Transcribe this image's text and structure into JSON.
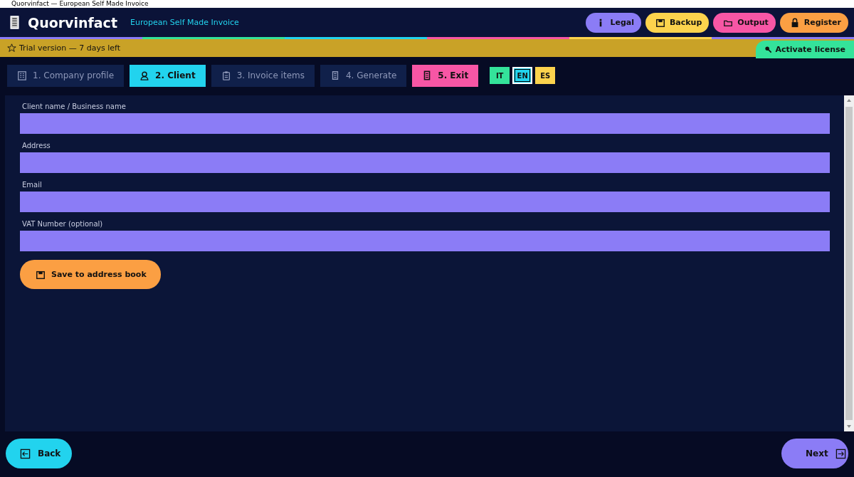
{
  "window": {
    "title": "Quorvinfact — European Self Made Invoice"
  },
  "header": {
    "app_name": "Quorvinfact",
    "subtitle": "European Self Made Invoice",
    "buttons": [
      {
        "label": "Legal",
        "color": "#8b7cf6"
      },
      {
        "label": "Backup",
        "color": "#fcd34d"
      },
      {
        "label": "Output",
        "color": "#f756a5"
      },
      {
        "label": "Register",
        "color": "#fb9f43"
      }
    ]
  },
  "trial_bar": {
    "text": "Trial version — 7 days left",
    "action": "Activate license"
  },
  "steps": [
    {
      "label": "1. Company profile",
      "kind": "step",
      "selected": false
    },
    {
      "label": "2. Client",
      "kind": "step",
      "selected": true
    },
    {
      "label": "3. Invoice items",
      "kind": "step",
      "selected": false
    },
    {
      "label": "4. Generate",
      "kind": "step",
      "selected": false
    },
    {
      "label": "5. Exit",
      "kind": "exit",
      "selected": false
    }
  ],
  "languages": [
    {
      "label": "IT",
      "color": "#34e39a",
      "selected": false
    },
    {
      "label": "EN",
      "color": "#22d3ee",
      "selected": true
    },
    {
      "label": "ES",
      "color": "#fcd34d",
      "selected": false
    }
  ],
  "form": {
    "fields": [
      {
        "label": "Client name / Business name"
      },
      {
        "label": "Address"
      },
      {
        "label": "Email"
      },
      {
        "label": "VAT Number (optional)"
      }
    ],
    "save_button": "Save to address book"
  },
  "footer": {
    "back": "Back",
    "next": "Next"
  }
}
